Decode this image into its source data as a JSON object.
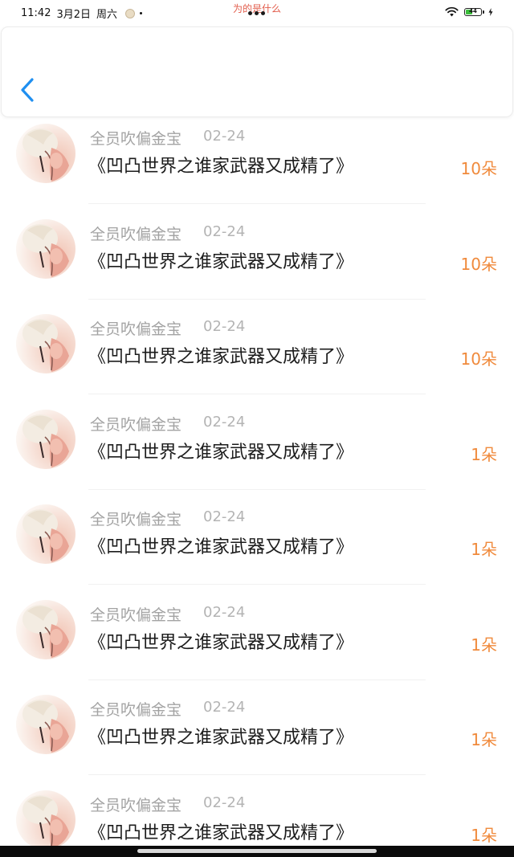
{
  "status_bar": {
    "time": "11:42",
    "date": "3月2日",
    "weekday": "周六",
    "center_title": "为的是什么",
    "battery_level": "44",
    "battery_fraction": 0.44,
    "battery_color": "#3bbf3b"
  },
  "header": {
    "back_icon": "chevron-left-icon",
    "accent_color": "#1f8ff0"
  },
  "list": {
    "items": [
      {
        "sender": "全员吹偏金宝",
        "date": "02-24",
        "title": "《凹凸世界之谁家武器又成精了》",
        "count": "10朵"
      },
      {
        "sender": "全员吹偏金宝",
        "date": "02-24",
        "title": "《凹凸世界之谁家武器又成精了》",
        "count": "10朵"
      },
      {
        "sender": "全员吹偏金宝",
        "date": "02-24",
        "title": "《凹凸世界之谁家武器又成精了》",
        "count": "10朵"
      },
      {
        "sender": "全员吹偏金宝",
        "date": "02-24",
        "title": "《凹凸世界之谁家武器又成精了》",
        "count": "1朵"
      },
      {
        "sender": "全员吹偏金宝",
        "date": "02-24",
        "title": "《凹凸世界之谁家武器又成精了》",
        "count": "1朵"
      },
      {
        "sender": "全员吹偏金宝",
        "date": "02-24",
        "title": "《凹凸世界之谁家武器又成精了》",
        "count": "1朵"
      },
      {
        "sender": "全员吹偏金宝",
        "date": "02-24",
        "title": "《凹凸世界之谁家武器又成精了》",
        "count": "1朵"
      },
      {
        "sender": "全员吹偏金宝",
        "date": "02-24",
        "title": "《凹凸世界之谁家武器又成精了》",
        "count": "1朵"
      }
    ],
    "count_color": "#f08a3c"
  }
}
